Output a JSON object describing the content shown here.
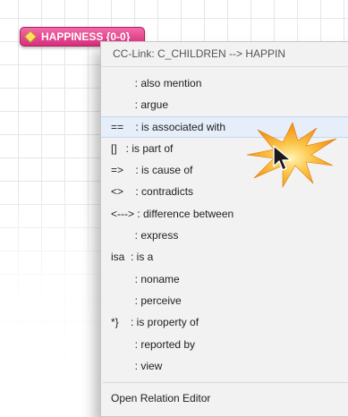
{
  "code_node": {
    "label": "HAPPINESS {0-0}",
    "color": "#e0448c"
  },
  "menu": {
    "header": "CC-Link: C_CHILDREN --> HAPPIN",
    "items": [
      {
        "label": "        : also mention"
      },
      {
        "label": "        : argue"
      },
      {
        "label": "==    : is associated with"
      },
      {
        "label": "[]   : is part of"
      },
      {
        "label": "=>    : is cause of"
      },
      {
        "label": "<>    : contradicts"
      },
      {
        "label": "<---> : difference between"
      },
      {
        "label": "        : express"
      },
      {
        "label": "isa  : is a"
      },
      {
        "label": "        : noname"
      },
      {
        "label": "        : perceive"
      },
      {
        "label": "*}    : is property of"
      },
      {
        "label": "        : reported by"
      },
      {
        "label": "        : view"
      }
    ],
    "highlighted_index": 2,
    "footer": "Open Relation Editor",
    "highlight_color": "#e5eef9"
  },
  "cursor": {
    "icon": "arrow-cursor-icon",
    "effect": "click-burst",
    "burst_color": "#f7a21b"
  }
}
